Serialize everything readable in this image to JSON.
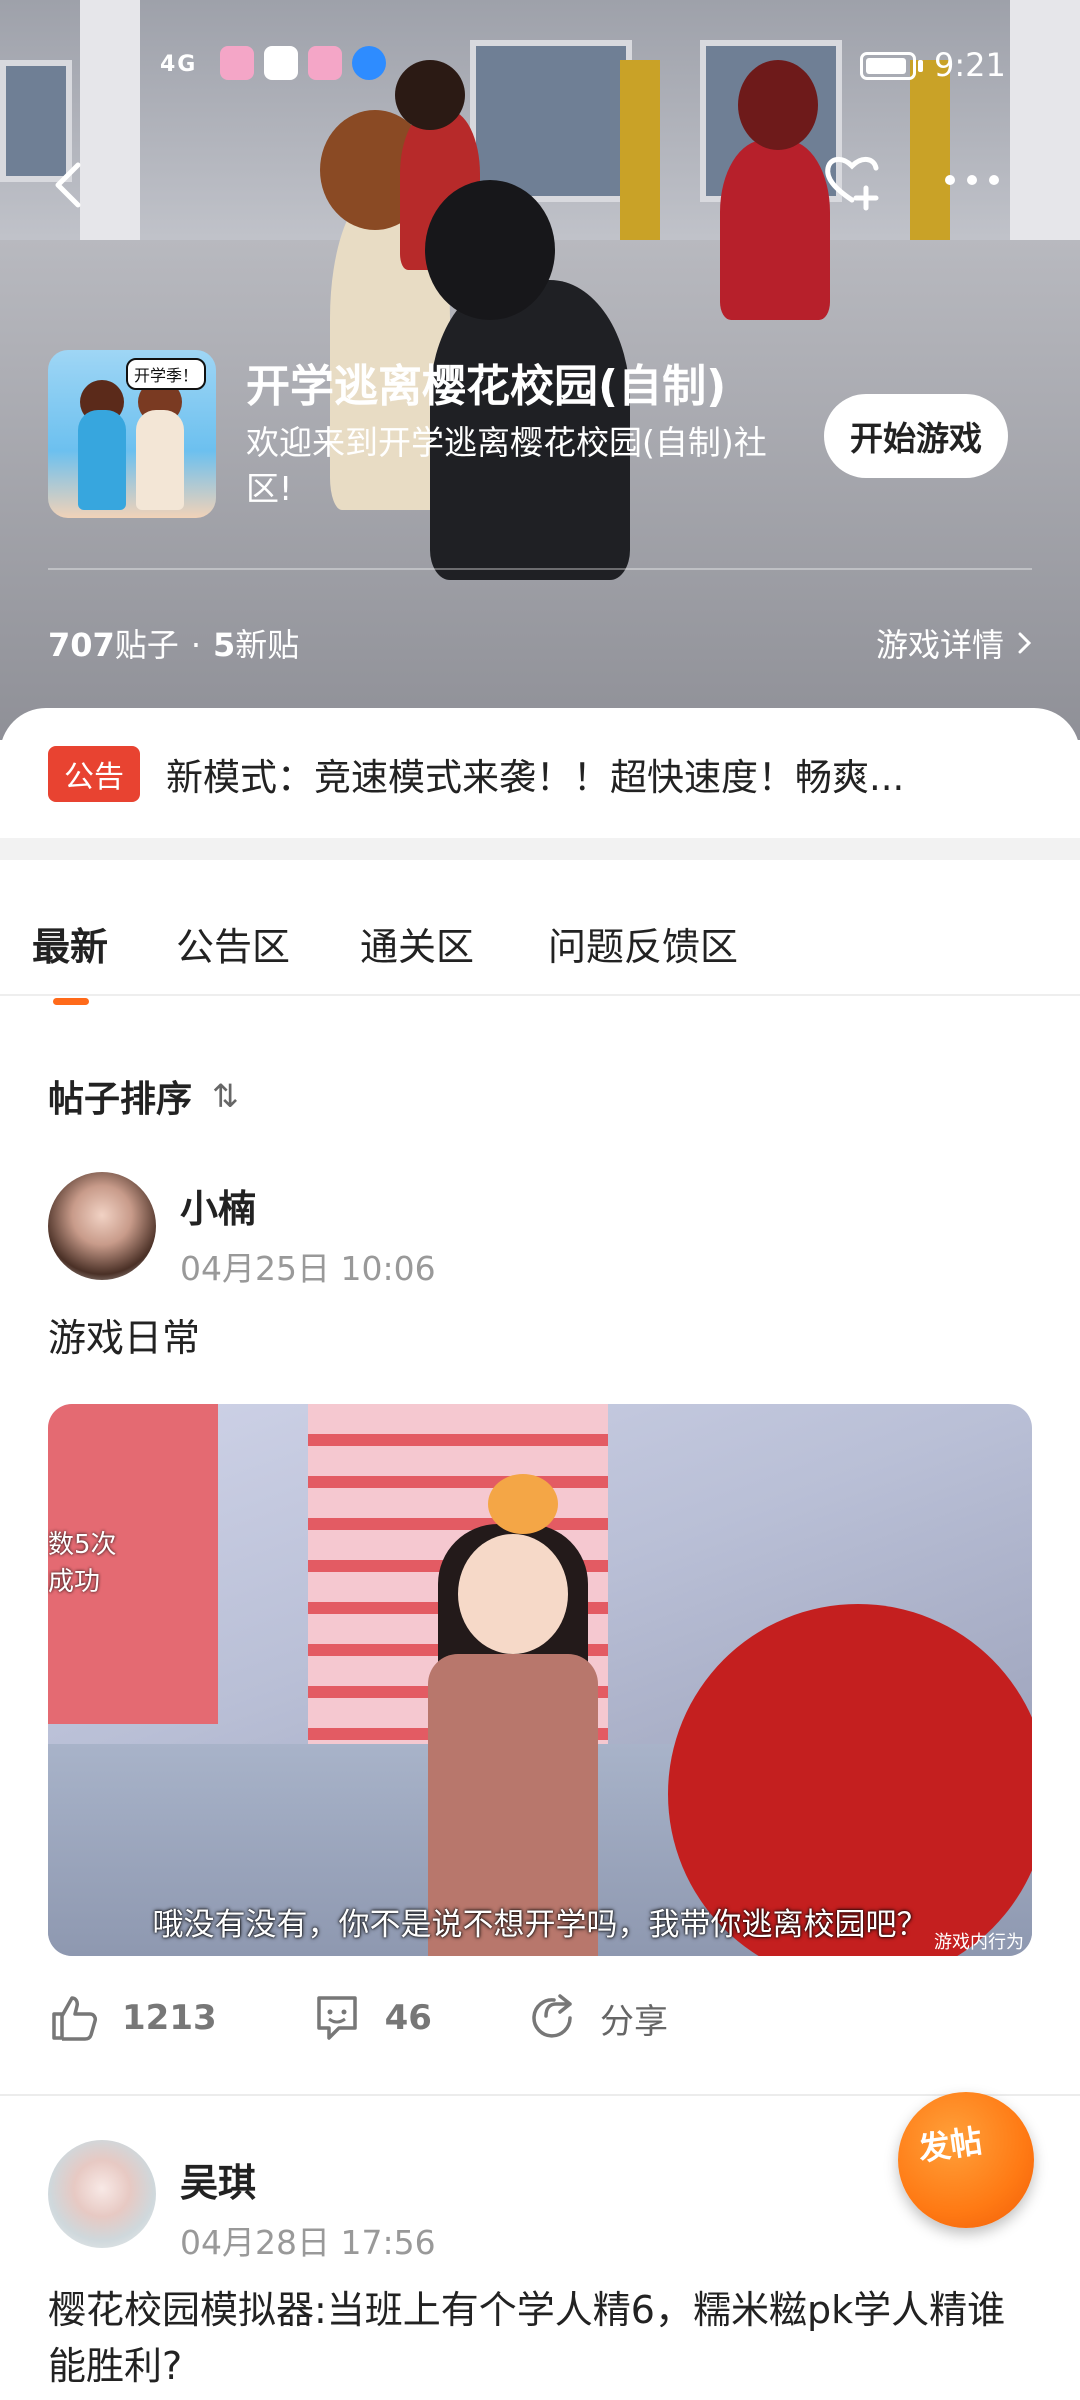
{
  "status_bar": {
    "network": "4G",
    "time": "9:21"
  },
  "colors": {
    "accent": "#ff6a1a",
    "notice_badge": "#e84331",
    "fab": "#ff7a14"
  },
  "header": {
    "game_title": "开学逃离樱花校园(自制)",
    "game_icon_tag": "开学季！",
    "welcome_text": "欢迎来到开学逃离樱花校园(自制)社区!",
    "play_button": "开始游戏",
    "post_count": "707",
    "post_count_label": "贴子",
    "dot": "·",
    "new_count": "5",
    "new_count_label": "新贴",
    "details_link": "游戏详情"
  },
  "notice": {
    "badge": "公告",
    "text": "新模式：竞速模式来袭！！超快速度！畅爽..."
  },
  "tabs": [
    {
      "label": "最新"
    },
    {
      "label": "公告区"
    },
    {
      "label": "通关区"
    },
    {
      "label": "问题反馈区"
    }
  ],
  "sort_label": "帖子排序",
  "posts": [
    {
      "author": "小楠",
      "time": "04月25日 10:06",
      "title": "游戏日常",
      "media_overlay": "数5次\n成功",
      "caption": "哦没有没有，你不是说不想开学吗，我带你逃离校园吧？",
      "watermark": "游戏内行为",
      "likes": "1213",
      "comments": "46",
      "share": "分享"
    },
    {
      "author": "吴琪",
      "time": "04月28日 17:56",
      "title": "樱花校园模拟器:当班上有个学人精6，糯米糍pk学人精谁能胜利?"
    }
  ],
  "fab_label": "发帖"
}
